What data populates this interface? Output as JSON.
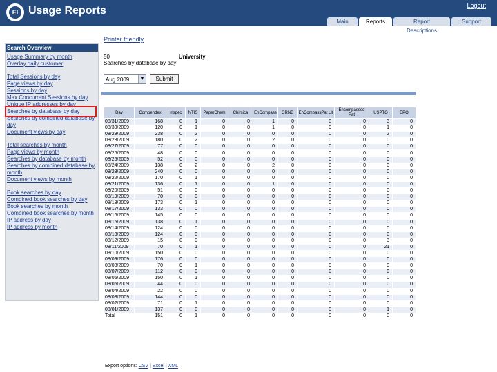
{
  "header": {
    "logo_text": "EI",
    "title": "Usage Reports",
    "logout": "Logout",
    "tabs": [
      "Main",
      "Reports",
      "Report Descriptions",
      "Support"
    ],
    "active_tab": "Reports"
  },
  "sidebar": {
    "header": "Search Overview",
    "groups": [
      [
        "Usage Summary by month",
        "Overlay daily customer"
      ],
      [
        "Total Sessions by day",
        "Page views by day",
        "Sessions by day",
        "Max Concurrent Sessions by day",
        "Unique IP addresses by day",
        "Searches by database by day",
        "Searches by combined database by day",
        "Document views by day"
      ],
      [
        "Total searches by month",
        "Page views by month",
        "Searches by database by month",
        "Searches by combined database by month",
        "Document views by month"
      ],
      [
        "Book searches by day",
        "Combined book searches by day",
        "Book searches by month",
        "Combined book searches by month",
        "IP address by day",
        "IP address by month"
      ]
    ],
    "selected": "Searches by database by day"
  },
  "main": {
    "printer_friendly": "Printer friendly",
    "account_id": "50",
    "institution": "University",
    "report_title": "Searches by database by day",
    "month_value": "Aug 2009",
    "submit_label": "Submit",
    "export_label": "Export options:",
    "export_links": [
      "CSV",
      "Excel",
      "XML"
    ]
  },
  "table": {
    "columns": [
      "Day",
      "Compendex",
      "Inspec",
      "NTIS",
      "PaperChem",
      "Chimica",
      "EnCompass",
      "GRNB",
      "EnCompassPat Lit",
      "Encompassed Pat",
      "USPTO",
      "EPO"
    ],
    "rows": [
      [
        "08/31/2009",
        "168",
        "0",
        "1",
        "0",
        "0",
        "1",
        "0",
        "0",
        "0",
        "3",
        "0"
      ],
      [
        "08/30/2009",
        "120",
        "0",
        "1",
        "0",
        "0",
        "1",
        "0",
        "0",
        "0",
        "1",
        "0"
      ],
      [
        "08/29/2009",
        "238",
        "0",
        "2",
        "0",
        "0",
        "0",
        "0",
        "0",
        "0",
        "2",
        "0"
      ],
      [
        "08/28/2009",
        "180",
        "0",
        "2",
        "0",
        "0",
        "2",
        "0",
        "0",
        "0",
        "0",
        "0"
      ],
      [
        "08/27/2009",
        "77",
        "0",
        "0",
        "0",
        "0",
        "0",
        "0",
        "0",
        "0",
        "0",
        "0"
      ],
      [
        "08/26/2009",
        "48",
        "0",
        "0",
        "0",
        "0",
        "0",
        "0",
        "0",
        "0",
        "0",
        "0"
      ],
      [
        "08/25/2009",
        "52",
        "0",
        "0",
        "0",
        "0",
        "0",
        "0",
        "0",
        "0",
        "0",
        "0"
      ],
      [
        "08/24/2009",
        "138",
        "0",
        "2",
        "0",
        "0",
        "2",
        "0",
        "0",
        "0",
        "0",
        "0"
      ],
      [
        "08/23/2009",
        "240",
        "0",
        "0",
        "0",
        "0",
        "0",
        "0",
        "0",
        "0",
        "0",
        "0"
      ],
      [
        "08/22/2009",
        "170",
        "0",
        "1",
        "0",
        "0",
        "0",
        "0",
        "0",
        "0",
        "0",
        "0"
      ],
      [
        "08/21/2009",
        "136",
        "0",
        "1",
        "0",
        "0",
        "1",
        "0",
        "0",
        "0",
        "0",
        "0"
      ],
      [
        "08/20/2009",
        "51",
        "0",
        "0",
        "0",
        "0",
        "0",
        "0",
        "0",
        "0",
        "0",
        "0"
      ],
      [
        "08/19/2009",
        "70",
        "0",
        "0",
        "0",
        "0",
        "0",
        "0",
        "0",
        "0",
        "0",
        "0"
      ],
      [
        "08/18/2009",
        "173",
        "0",
        "1",
        "0",
        "0",
        "0",
        "0",
        "0",
        "0",
        "0",
        "0"
      ],
      [
        "08/17/2009",
        "133",
        "0",
        "0",
        "0",
        "0",
        "0",
        "0",
        "0",
        "0",
        "0",
        "0"
      ],
      [
        "08/16/2009",
        "145",
        "0",
        "0",
        "0",
        "0",
        "0",
        "0",
        "0",
        "0",
        "0",
        "0"
      ],
      [
        "08/15/2009",
        "138",
        "0",
        "1",
        "0",
        "0",
        "0",
        "0",
        "0",
        "0",
        "0",
        "0"
      ],
      [
        "08/14/2009",
        "124",
        "0",
        "0",
        "0",
        "0",
        "0",
        "0",
        "0",
        "0",
        "0",
        "0"
      ],
      [
        "08/13/2009",
        "124",
        "0",
        "0",
        "0",
        "0",
        "0",
        "0",
        "0",
        "0",
        "0",
        "0"
      ],
      [
        "08/12/2009",
        "15",
        "0",
        "0",
        "0",
        "0",
        "0",
        "0",
        "0",
        "0",
        "3",
        "0"
      ],
      [
        "08/11/2009",
        "70",
        "0",
        "1",
        "0",
        "0",
        "0",
        "0",
        "0",
        "0",
        "21",
        "0"
      ],
      [
        "08/10/2009",
        "150",
        "0",
        "0",
        "0",
        "0",
        "0",
        "0",
        "0",
        "0",
        "0",
        "0"
      ],
      [
        "08/09/2009",
        "176",
        "0",
        "0",
        "0",
        "0",
        "0",
        "0",
        "0",
        "0",
        "0",
        "0"
      ],
      [
        "08/08/2009",
        "70",
        "0",
        "1",
        "0",
        "0",
        "0",
        "0",
        "0",
        "0",
        "0",
        "0"
      ],
      [
        "08/07/2009",
        "112",
        "0",
        "0",
        "0",
        "0",
        "0",
        "0",
        "0",
        "0",
        "0",
        "0"
      ],
      [
        "08/06/2009",
        "150",
        "0",
        "1",
        "0",
        "0",
        "0",
        "0",
        "0",
        "0",
        "0",
        "0"
      ],
      [
        "08/05/2009",
        "44",
        "0",
        "0",
        "0",
        "0",
        "0",
        "0",
        "0",
        "0",
        "0",
        "0"
      ],
      [
        "08/04/2009",
        "22",
        "0",
        "0",
        "0",
        "0",
        "0",
        "0",
        "0",
        "0",
        "0",
        "0"
      ],
      [
        "08/03/2009",
        "144",
        "0",
        "0",
        "0",
        "0",
        "0",
        "0",
        "0",
        "0",
        "0",
        "0"
      ],
      [
        "08/02/2009",
        "71",
        "0",
        "1",
        "0",
        "0",
        "0",
        "0",
        "0",
        "0",
        "0",
        "0"
      ],
      [
        "08/01/2009",
        "137",
        "0",
        "0",
        "0",
        "0",
        "0",
        "0",
        "0",
        "0",
        "1",
        "0"
      ],
      [
        "Total",
        "151",
        "0",
        "1",
        "0",
        "0",
        "0",
        "0",
        "0",
        "0",
        "0",
        "0"
      ]
    ]
  }
}
